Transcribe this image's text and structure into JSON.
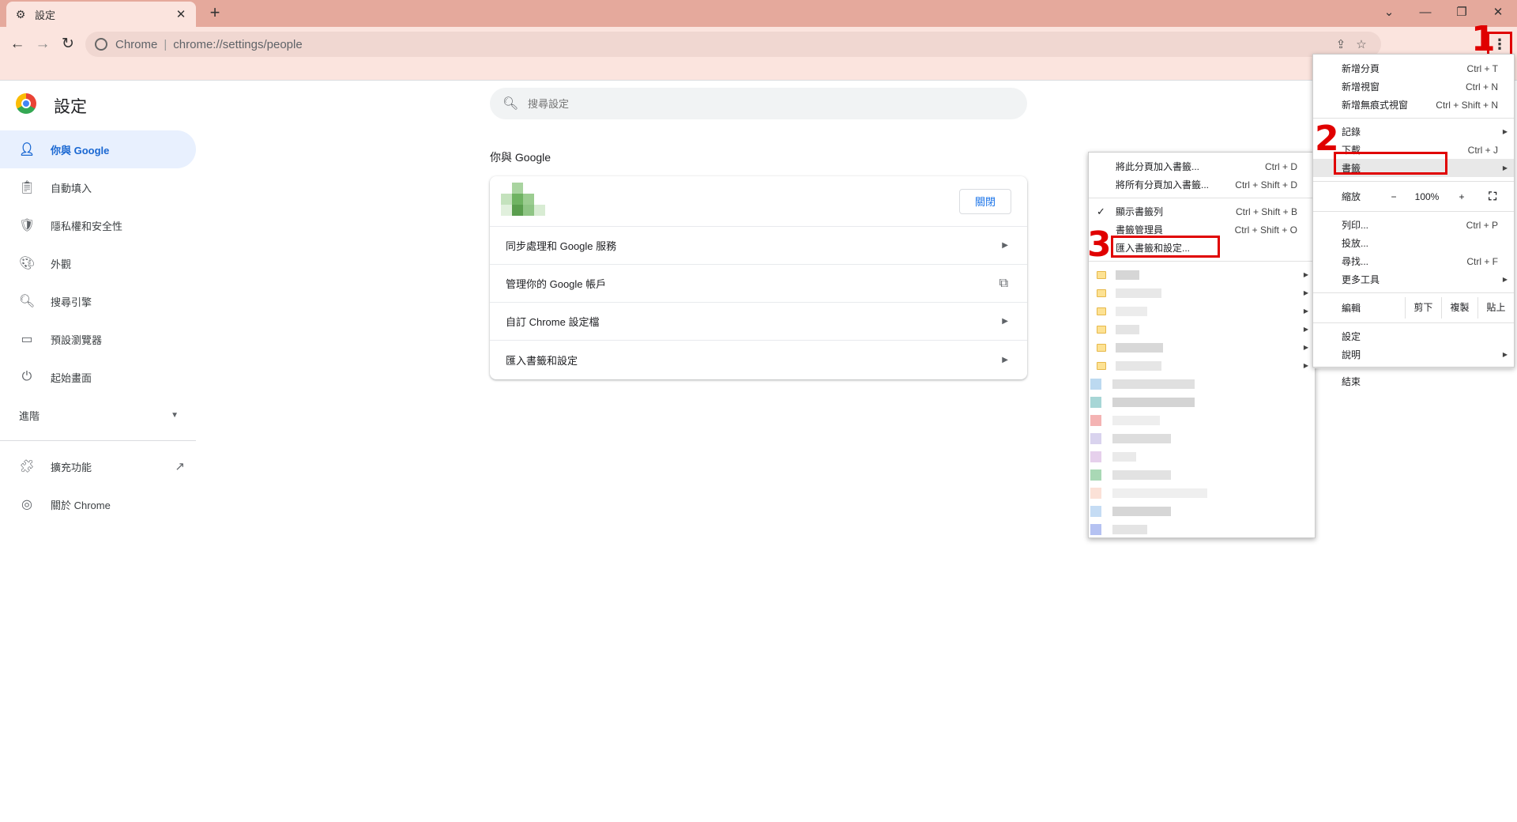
{
  "tab": {
    "title": "設定",
    "close": "✕"
  },
  "window": {
    "minimize": "—",
    "restore": "❐",
    "close": "✕",
    "dropdown": "⌄"
  },
  "omnibox": {
    "scheme": "Chrome",
    "separator": "|",
    "url": "chrome://settings/people"
  },
  "settings": {
    "title": "設定",
    "search_placeholder": "搜尋設定",
    "nav": [
      {
        "label": "你與 Google",
        "icon": "person-icon"
      },
      {
        "label": "自動填入",
        "icon": "clipboard-icon"
      },
      {
        "label": "隱私權和安全性",
        "icon": "shield-icon"
      },
      {
        "label": "外觀",
        "icon": "palette-icon"
      },
      {
        "label": "搜尋引擎",
        "icon": "search-icon"
      },
      {
        "label": "預設瀏覽器",
        "icon": "browser-icon"
      },
      {
        "label": "起始畫面",
        "icon": "power-icon"
      }
    ],
    "advanced": "進階",
    "extensions": "擴充功能",
    "about": "關於 Chrome",
    "section_title": "你與 Google",
    "turn_off": "關閉",
    "rows": [
      "同步處理和 Google 服務",
      "管理你的 Google 帳戶",
      "自訂 Chrome 設定檔",
      "匯入書籤和設定"
    ]
  },
  "bookmarks_menu": {
    "items": [
      {
        "label": "將此分頁加入書籤...",
        "shortcut": "Ctrl + D"
      },
      {
        "label": "將所有分頁加入書籤...",
        "shortcut": "Ctrl + Shift + D"
      },
      {
        "label": "顯示書籤列",
        "shortcut": "Ctrl + Shift + B",
        "checked": true
      },
      {
        "label": "書籤管理員",
        "shortcut": "Ctrl + Shift + O"
      },
      {
        "label": "匯入書籤和設定...",
        "shortcut": ""
      }
    ]
  },
  "main_menu": {
    "new_tab": {
      "label": "新增分頁",
      "shortcut": "Ctrl + T"
    },
    "new_window": {
      "label": "新增視窗",
      "shortcut": "Ctrl + N"
    },
    "incognito": {
      "label": "新增無痕式視窗",
      "shortcut": "Ctrl + Shift + N"
    },
    "history": "記錄",
    "downloads": {
      "label": "下載",
      "shortcut": "Ctrl + J"
    },
    "bookmarks": "書籤",
    "zoom": {
      "label": "縮放",
      "minus": "−",
      "value": "100%",
      "plus": "+"
    },
    "print": {
      "label": "列印...",
      "shortcut": "Ctrl + P"
    },
    "cast": "投放...",
    "find": {
      "label": "尋找...",
      "shortcut": "Ctrl + F"
    },
    "more_tools": "更多工具",
    "edit": {
      "label": "編輯",
      "cut": "剪下",
      "copy": "複製",
      "paste": "貼上"
    },
    "settings": "設定",
    "help": "說明",
    "exit": "結束"
  },
  "annotations": {
    "step1": "1",
    "step2": "2",
    "step3": "3"
  }
}
